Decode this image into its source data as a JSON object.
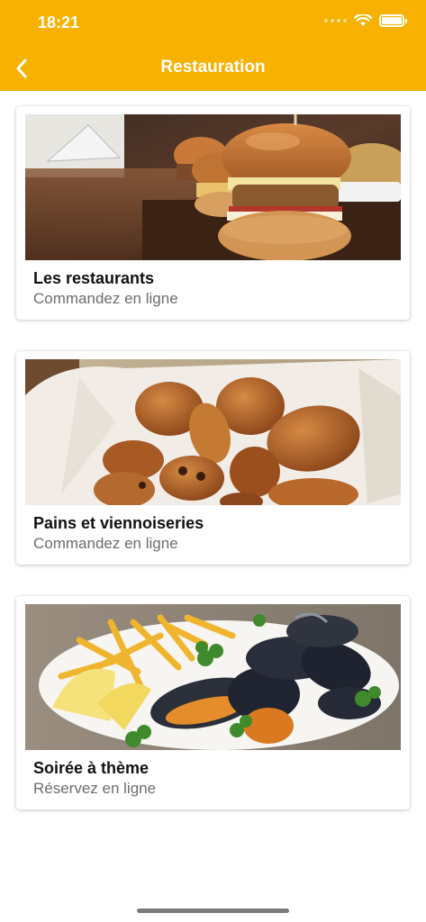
{
  "status_bar": {
    "time": "18:21"
  },
  "nav": {
    "title": "Restauration",
    "back_icon": "chevron-left-icon"
  },
  "colors": {
    "brand": "#F7B100",
    "title_text": "#111111",
    "subtitle_text": "#6d6d6d"
  },
  "cards": [
    {
      "title": "Les restaurants",
      "subtitle": "Commandez en ligne",
      "image": "burger-sliders-photo"
    },
    {
      "title": "Pains et viennoiseries",
      "subtitle": "Commandez en ligne",
      "image": "pastries-basket-photo"
    },
    {
      "title": "Soirée à thème",
      "subtitle": "Réservez en ligne",
      "image": "moules-frites-photo"
    }
  ]
}
